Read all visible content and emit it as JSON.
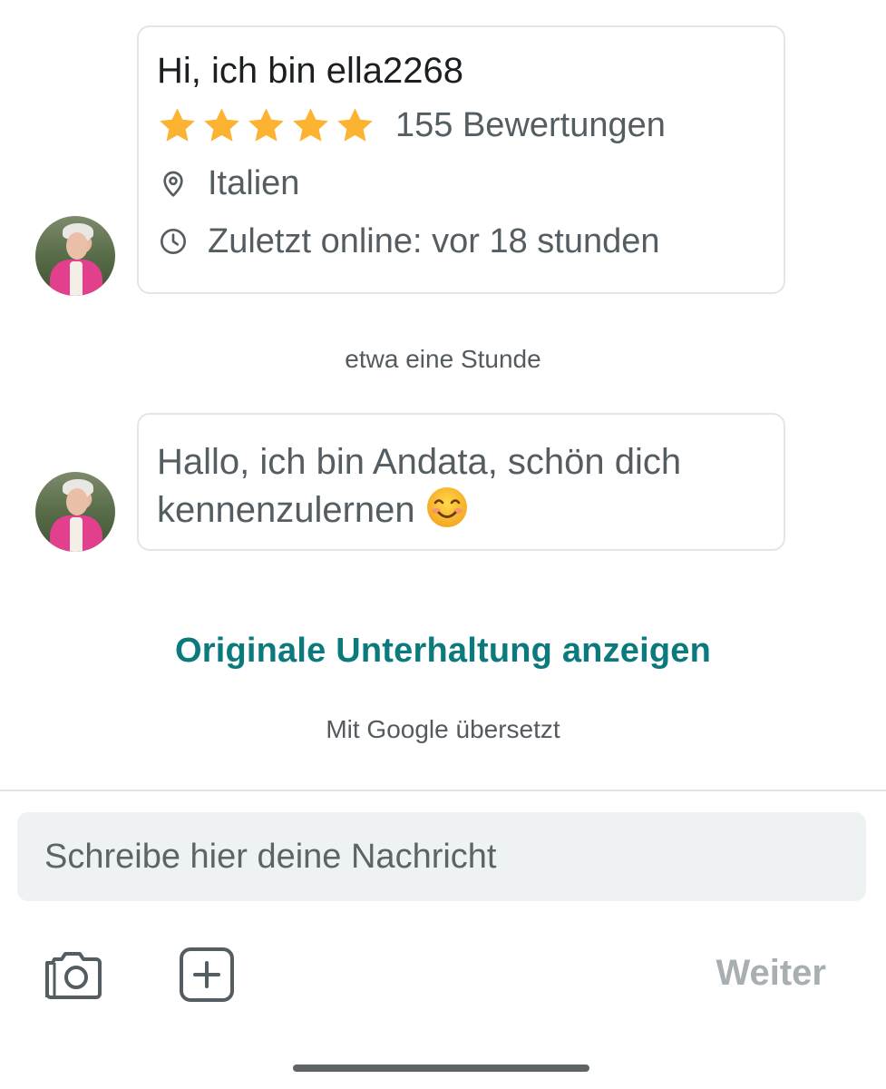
{
  "profile": {
    "greeting": "Hi, ich bin ella2268",
    "rating_stars": 5,
    "reviews": "155 Bewertungen",
    "location": "Italien",
    "last_online": "Zuletzt online: vor 18 stunden",
    "star_color": "#fbb331"
  },
  "timestamp": "etwa eine Stunde",
  "message": {
    "text": "Hallo, ich bin Andata, schön dich kennenzulernen",
    "emoji": "smiling-face-icon"
  },
  "translation": {
    "link_label": "Originale Unterhaltung anzeigen",
    "note": "Mit Google übersetzt",
    "link_color": "#0b7a7d"
  },
  "composer": {
    "placeholder": "Schreibe hier deine Nachricht",
    "value": "",
    "send_label": "Weiter"
  },
  "icons": {
    "camera": "camera-icon",
    "add": "plus-square-icon",
    "location": "map-pin-icon",
    "time": "clock-icon"
  }
}
